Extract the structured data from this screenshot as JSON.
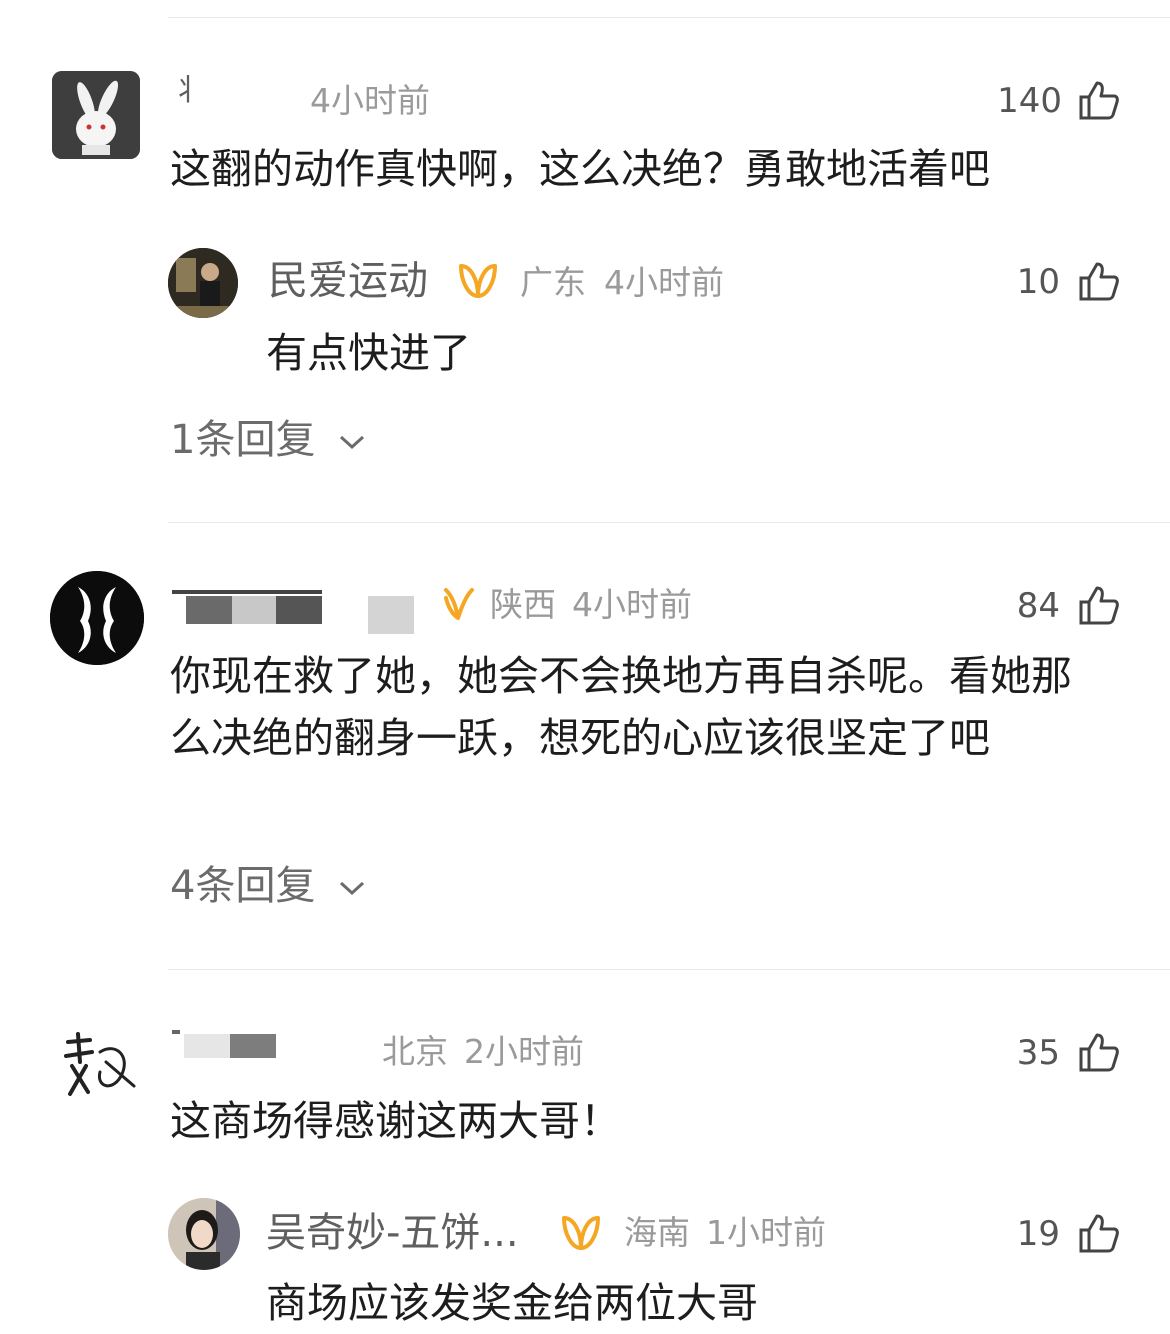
{
  "comments": [
    {
      "user": "",
      "location": "",
      "time": "4小时前",
      "likes": "140",
      "text": "这翻的动作真快啊，这么决绝？勇敢地活着吧",
      "sub_reply": {
        "user": "民爱运动",
        "location": "广东",
        "time": "4小时前",
        "likes": "10",
        "text": "有点快进了"
      },
      "replies_link": "1条回复"
    },
    {
      "user": "",
      "location": "陕西",
      "time": "4小时前",
      "likes": "84",
      "text": "你现在救了她，她会不会换地方再自杀呢。看她那么决绝的翻身一跃，想死的心应该很坚定了吧",
      "replies_link": "4条回复"
    },
    {
      "user": "",
      "location": "北京",
      "time": "2小时前",
      "likes": "35",
      "text": "这商场得感谢这两大哥！",
      "sub_reply": {
        "user": "吴奇妙-五饼...",
        "location": "海南",
        "time": "1小时前",
        "likes": "19",
        "text": "商场应该发奖金给两位大哥"
      }
    }
  ],
  "colors": {
    "vip_badge": "#f5a623",
    "meta": "#9a9a9a",
    "text": "#1d1d1d"
  },
  "icons": {
    "like": "thumbs-up-icon",
    "expand": "chevron-down-icon",
    "vip": "vip-badge-icon"
  }
}
